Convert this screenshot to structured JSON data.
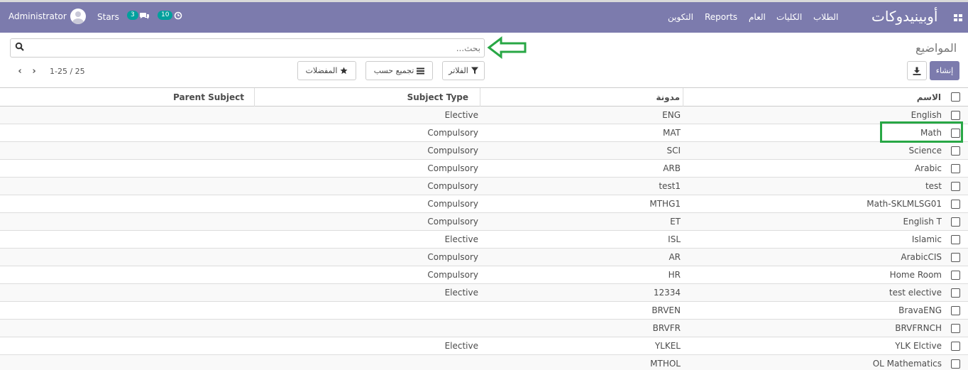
{
  "navbar": {
    "user": "Administrator",
    "stars": "Stars",
    "messages_count": "3",
    "activities_count": "10",
    "menu": [
      "التكوين",
      "Reports",
      "العام",
      "الكليات",
      "الطلاب"
    ],
    "brand": "أوبينيدوكات"
  },
  "control": {
    "breadcrumb": "المواضيع",
    "search_placeholder": "بحث...",
    "filters": "الفلاتر",
    "group_by": "تجميع حسب",
    "favorites": "المفضلات",
    "create": "إنشاء",
    "pager": "1-25 / 25"
  },
  "table": {
    "headers": {
      "name": "الاسم",
      "code": "مدونة",
      "type": "Subject Type",
      "parent": "Parent Subject"
    },
    "rows": [
      {
        "name": "English",
        "code": "ENG",
        "type": "Elective",
        "parent": ""
      },
      {
        "name": "Math",
        "code": "MAT",
        "type": "Compulsory",
        "parent": ""
      },
      {
        "name": "Science",
        "code": "SCI",
        "type": "Compulsory",
        "parent": ""
      },
      {
        "name": "Arabic",
        "code": "ARB",
        "type": "Compulsory",
        "parent": ""
      },
      {
        "name": "test",
        "code": "test1",
        "type": "Compulsory",
        "parent": ""
      },
      {
        "name": "Math-SKLMLSG01",
        "code": "MTHG1",
        "type": "Compulsory",
        "parent": ""
      },
      {
        "name": "English T",
        "code": "ET",
        "type": "Compulsory",
        "parent": ""
      },
      {
        "name": "Islamic",
        "code": "ISL",
        "type": "Elective",
        "parent": ""
      },
      {
        "name": "ArabicCIS",
        "code": "AR",
        "type": "Compulsory",
        "parent": ""
      },
      {
        "name": "Home Room",
        "code": "HR",
        "type": "Compulsory",
        "parent": ""
      },
      {
        "name": "test elective",
        "code": "12334",
        "type": "Elective",
        "parent": ""
      },
      {
        "name": "BravaENG",
        "code": "BRVEN",
        "type": "",
        "parent": ""
      },
      {
        "name": "BRVFRNCH",
        "code": "BRVFR",
        "type": "",
        "parent": ""
      },
      {
        "name": "YLK Elctive",
        "code": "YLKEL",
        "type": "Elective",
        "parent": ""
      },
      {
        "name": "OL Mathematics",
        "code": "MTHOL",
        "type": "",
        "parent": ""
      }
    ]
  }
}
